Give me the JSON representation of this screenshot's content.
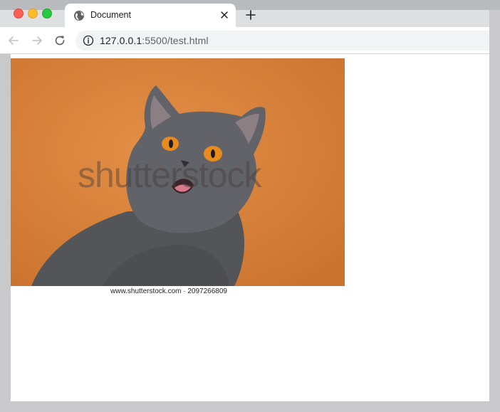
{
  "browser": {
    "tab": {
      "title": "Document"
    },
    "address_bar": {
      "host": "127.0.0.1",
      "path": ":5500/test.html"
    }
  },
  "page": {
    "image": {
      "watermark": "shutterstock",
      "caption": "www.shutterstock.com · 2097266809"
    }
  },
  "colors": {
    "photo_background": "#d9823d",
    "cat_fur": "#5e5f63",
    "cat_eyes": "#e88a1c"
  },
  "icons": {
    "tab_favicon": "globe-icon",
    "tab_close": "close-icon",
    "new_tab": "plus-icon",
    "back": "arrow-left-icon",
    "forward": "arrow-right-icon",
    "reload": "reload-icon",
    "site_info": "info-icon"
  }
}
